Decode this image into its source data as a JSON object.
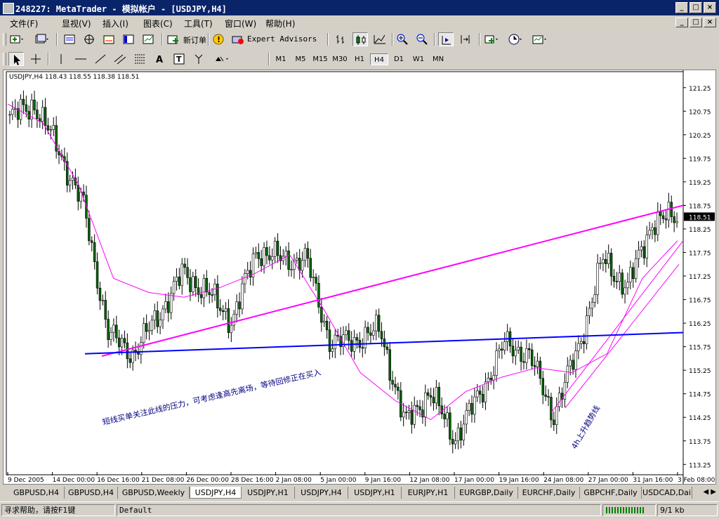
{
  "window": {
    "title": "248227: MetaTrader - 模拟帐户 - [USDJPY,H4]",
    "controls": [
      "_",
      "□",
      "×"
    ]
  },
  "menu": [
    "文件(F)",
    "显视(V)",
    "插入(I)",
    "图表(C)",
    "工具(T)",
    "窗口(W)",
    "帮助(H)"
  ],
  "toolbar1": {
    "new_order": "新订单",
    "expert_advisors": "Expert Advisors"
  },
  "timeframes": [
    "M1",
    "M5",
    "M15",
    "M30",
    "H1",
    "H4",
    "D1",
    "W1",
    "MN"
  ],
  "active_timeframe": "H4",
  "chart_data": {
    "type": "candlestick",
    "symbol_header": "USDJPY,H4  118.43 118.55 118.38 118.51",
    "y_ticks": [
      "121.25",
      "120.75",
      "120.25",
      "119.75",
      "119.25",
      "118.75",
      "118.25",
      "117.75",
      "117.25",
      "116.75",
      "116.25",
      "115.75",
      "115.25",
      "114.75",
      "114.25",
      "113.75",
      "113.25"
    ],
    "ylim": [
      113.15,
      121.5
    ],
    "current_price": "118.51",
    "x_ticks": [
      "9 Dec 2005",
      "14 Dec 00:00",
      "16 Dec 16:00",
      "21 Dec 08:00",
      "26 Dec 00:00",
      "28 Dec 16:00",
      "2 Jan 08:00",
      "5 Jan 00:00",
      "9 Jan 16:00",
      "12 Jan 08:00",
      "17 Jan 00:00",
      "19 Jan 16:00",
      "24 Jan 08:00",
      "27 Jan 00:00",
      "31 Jan 16:00",
      "3 Feb 08:00"
    ],
    "key_closes": [
      120.6,
      120.9,
      119.9,
      118.7,
      116.0,
      115.6,
      116.4,
      117.3,
      116.9,
      116.3,
      117.8,
      117.6,
      117.6,
      115.8,
      115.9,
      116.1,
      114.1,
      114.8,
      113.8,
      114.7,
      115.8,
      115.6,
      114.3,
      115.7,
      117.6,
      117.0,
      118.4,
      118.51
    ],
    "ma_points": [
      120.9,
      120.5,
      119.2,
      117.2,
      116.9,
      116.8,
      117.0,
      117.3,
      117.7,
      116.5,
      115.2,
      114.6,
      114.2,
      114.8,
      115.1,
      115.3,
      115.2,
      115.6,
      117.2,
      118.0
    ],
    "annotations": [
      {
        "text": "短线买单关注此线的压力，可考虑逢高先离场，等待回修正在买入",
        "color": "#000080"
      },
      {
        "text": "4h上升趋势线",
        "color": "#000080"
      }
    ],
    "lines": [
      {
        "name": "resistance-line",
        "color": "#ff00ff",
        "from": [
          115.55,
          115.55
        ],
        "to": [
          118.75,
          118.75
        ]
      },
      {
        "name": "support-line",
        "color": "#0000ff",
        "from": [
          115.6,
          115.6
        ],
        "to": [
          116.05,
          116.05
        ]
      }
    ],
    "colors": {
      "bull": "#ffffff",
      "bear": "#006400",
      "ma": "#ff00ff",
      "support": "#0000ff",
      "resistance": "#ff00ff"
    }
  },
  "tabs": [
    "GBPUSD,H4",
    "GBPUSD,H4",
    "GBPUSD,Weekly",
    "USDJPY,H4",
    "USDJPY,H1",
    "USDJPY,H4",
    "USDJPY,H1",
    "EURJPY,H1",
    "EURGBP,Daily",
    "EURCHF,Daily",
    "GBPCHF,Daily",
    "USDCAD,Dai"
  ],
  "active_tab_index": 3,
  "status": {
    "help": "寻求帮助，请按F1键",
    "profile": "Default",
    "traffic": "9/1 kb"
  }
}
